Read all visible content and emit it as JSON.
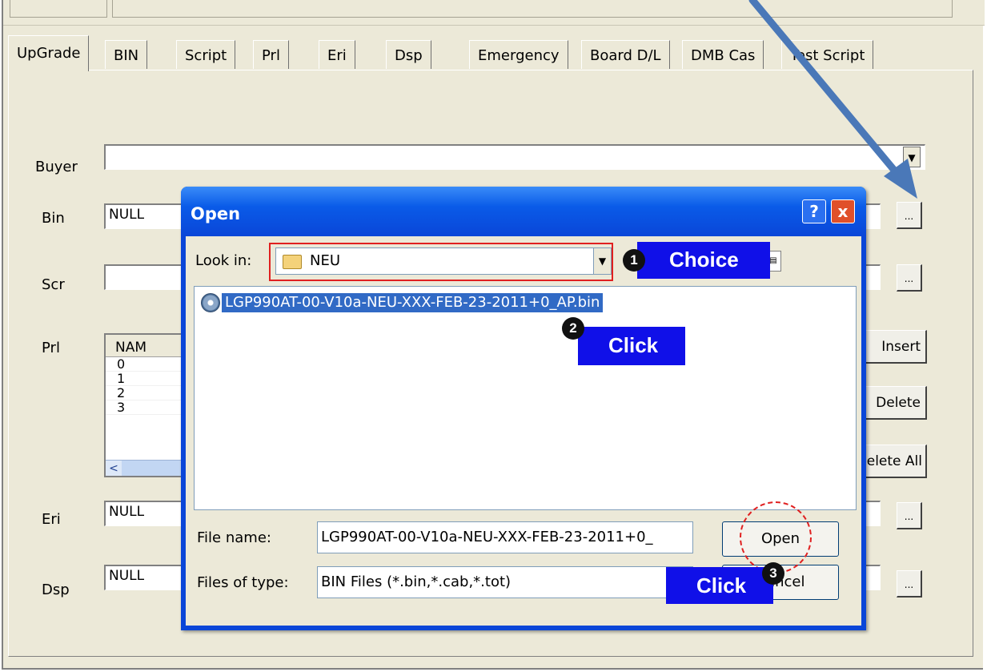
{
  "tabs": [
    "UpGrade",
    "BIN",
    "Script",
    "Prl",
    "Eri",
    "Dsp",
    "Emergency",
    "Board D/L",
    "DMB Cas",
    "Test Script"
  ],
  "active_tab": "UpGrade",
  "form": {
    "buyer_label": "Buyer",
    "bin_label": "Bin",
    "bin_value": "NULL",
    "scr_label": "Scr",
    "prl_label": "Prl",
    "eri_label": "Eri",
    "eri_value": "NULL",
    "dsp_label": "Dsp",
    "dsp_value": "NULL",
    "browse_label": "...",
    "insert_label": "Insert",
    "delete_label": "Delete",
    "delete_all_label": "Delete All"
  },
  "prl_list": {
    "header": "NAM",
    "rows": [
      "0",
      "1",
      "2",
      "3"
    ],
    "scroll_left": "<"
  },
  "dialog": {
    "title": "Open",
    "help_label": "?",
    "close_label": "x",
    "look_in_label": "Look in:",
    "look_in_value": "NEU",
    "file_item": "LGP990AT-00-V10a-NEU-XXX-FEB-23-2011+0_AP.bin",
    "file_name_label": "File name:",
    "file_name_value": "LGP990AT-00-V10a-NEU-XXX-FEB-23-2011+0_",
    "files_of_type_label": "Files of type:",
    "files_of_type_value": "BIN Files (*.bin,*.cab,*.tot)",
    "open_button": "Open",
    "cancel_button": "Cancel"
  },
  "annotations": {
    "step1": "1",
    "step1_label": "Choice",
    "step2": "2",
    "step2_label": "Click",
    "step3": "3",
    "step3_label": "Click"
  },
  "colors": {
    "window_bg": "#ece9d8",
    "title_bar": "#0a46d8",
    "selection": "#316ac5",
    "callout": "#1010e8",
    "arrow": "#4a78b8",
    "highlight": "#e02020"
  }
}
